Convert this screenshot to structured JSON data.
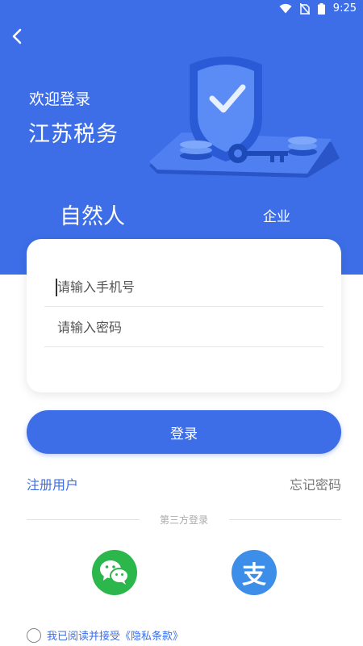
{
  "status_bar": {
    "time": "9:25",
    "icons": [
      "wifi-icon",
      "no-sim-icon",
      "battery-icon"
    ]
  },
  "header": {
    "welcome": "欢迎登录",
    "app_title": "江苏税务"
  },
  "tabs": [
    {
      "label": "自然人",
      "active": true
    },
    {
      "label": "企业",
      "active": false
    }
  ],
  "form": {
    "phone_placeholder": "请输入手机号",
    "password_placeholder": "请输入密码",
    "phone_value": "",
    "password_value": ""
  },
  "login_label": "登录",
  "links": {
    "register": "注册用户",
    "forgot": "忘记密码"
  },
  "third_party": {
    "label": "第三方登录",
    "providers": [
      {
        "name": "wechat",
        "icon": "wechat-icon"
      },
      {
        "name": "alipay",
        "icon": "alipay-icon",
        "glyph": "支"
      }
    ]
  },
  "agreement": {
    "text": "我已阅读并接受《隐私条款》",
    "checked": false
  },
  "colors": {
    "primary": "#3d6ee8",
    "wechat": "#2bb74b",
    "alipay": "#3d8ee8"
  }
}
